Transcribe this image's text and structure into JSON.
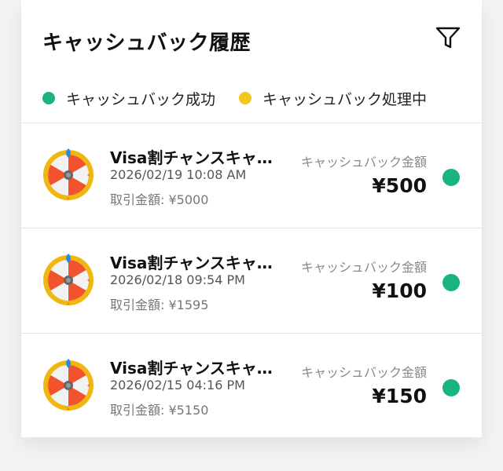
{
  "header": {
    "title": "キャッシュバック履歴",
    "filter_icon": "filter-icon"
  },
  "legend": [
    {
      "label": "キャッシュバック成功",
      "color": "#1bb37f"
    },
    {
      "label": "キャッシュバック処理中",
      "color": "#f2c81e"
    }
  ],
  "colors": {
    "success": "#1bb37f",
    "processing": "#f2c81e",
    "wheel_rim": "#f0b711",
    "wheel_red": "#f0532e",
    "wheel_white": "#f2f2f2",
    "wheel_pointer": "#2a8be0"
  },
  "transactions": [
    {
      "title": "Visa割チャンスキャッシュバック",
      "date": "2026/02/19 10:08 AM",
      "amount_label": "取引金額: ¥5000",
      "cashback_label": "キャッシュバック金額",
      "cashback_value": "¥500",
      "status": "success",
      "icon": "prize-wheel-icon"
    },
    {
      "title": "Visa割チャンスキャッシュバック",
      "date": "2026/02/18 09:54 PM",
      "amount_label": "取引金額: ¥1595",
      "cashback_label": "キャッシュバック金額",
      "cashback_value": "¥100",
      "status": "success",
      "icon": "prize-wheel-icon"
    },
    {
      "title": "Visa割チャンスキャッシュバック",
      "date": "2026/02/15 04:16 PM",
      "amount_label": "取引金額: ¥5150",
      "cashback_label": "キャッシュバック金額",
      "cashback_value": "¥150",
      "status": "success",
      "icon": "prize-wheel-icon"
    }
  ]
}
